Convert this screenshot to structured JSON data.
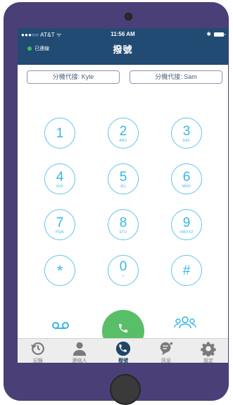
{
  "status_bar": {
    "carrier": "●●●○○ AT&T ᯤ",
    "time": "11:56 AM",
    "bluetooth": "✱"
  },
  "header": {
    "connection_status": "已連線",
    "title": "撥號"
  },
  "extension_buttons": [
    {
      "label": "分機代接: Kyle"
    },
    {
      "label": "分機代接: Sam"
    }
  ],
  "keypad": [
    {
      "digit": "1",
      "letters": ""
    },
    {
      "digit": "2",
      "letters": "ABC"
    },
    {
      "digit": "3",
      "letters": "DEF"
    },
    {
      "digit": "4",
      "letters": "GHI"
    },
    {
      "digit": "5",
      "letters": "JKL"
    },
    {
      "digit": "6",
      "letters": "MNO"
    },
    {
      "digit": "7",
      "letters": "PQR"
    },
    {
      "digit": "8",
      "letters": "STU"
    },
    {
      "digit": "9",
      "letters": "VWXYZ"
    },
    {
      "digit": "*",
      "letters": ""
    },
    {
      "digit": "0",
      "letters": "+"
    },
    {
      "digit": "#",
      "letters": ""
    }
  ],
  "tabs": [
    {
      "label": "記錄",
      "icon": "history-icon"
    },
    {
      "label": "連絡人",
      "icon": "contact-icon"
    },
    {
      "label": "撥號",
      "icon": "phone-icon"
    },
    {
      "label": "訊息",
      "icon": "message-icon"
    },
    {
      "label": "設定",
      "icon": "gear-icon"
    }
  ],
  "active_tab": "撥號",
  "colors": {
    "header_bg": "#214b73",
    "key_accent": "#35b7e6",
    "call_button": "#58bf68",
    "connected_dot": "#35c455",
    "phone_frame": "#4b3f78"
  }
}
